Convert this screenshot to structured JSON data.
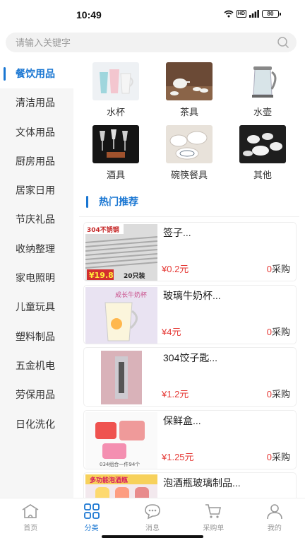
{
  "status": {
    "time": "10:49",
    "network": "HD",
    "battery": "80"
  },
  "search": {
    "placeholder": "请输入关键字"
  },
  "sidebar": {
    "items": [
      {
        "label": "餐饮用品",
        "active": true
      },
      {
        "label": "清洁用品"
      },
      {
        "label": "文体用品"
      },
      {
        "label": "厨房用品"
      },
      {
        "label": "居家日用"
      },
      {
        "label": "节庆礼品"
      },
      {
        "label": "收纳整理"
      },
      {
        "label": "家电照明"
      },
      {
        "label": "儿童玩具"
      },
      {
        "label": "塑料制品"
      },
      {
        "label": "五金机电"
      },
      {
        "label": "劳保用品"
      },
      {
        "label": "日化洗化"
      }
    ]
  },
  "categories": [
    {
      "label": "水杯",
      "icon": "cups-image"
    },
    {
      "label": "茶具",
      "icon": "tea-set-image"
    },
    {
      "label": "水壶",
      "icon": "kettle-image"
    },
    {
      "label": "酒具",
      "icon": "wine-glasses-image"
    },
    {
      "label": "碗筷餐具",
      "icon": "tableware-image"
    },
    {
      "label": "其他",
      "icon": "other-image"
    }
  ],
  "hot": {
    "title": "热门推荐"
  },
  "products": [
    {
      "name": "签子...",
      "price": "¥0.2元",
      "sold": "0",
      "sold_suffix": "采购",
      "image_text": {
        "top": "304不锈钢",
        "price": "¥19.8",
        "count": "20只装"
      }
    },
    {
      "name": "玻璃牛奶杯...",
      "price": "¥4元",
      "sold": "0",
      "sold_suffix": "采购",
      "image_text": {
        "title": "成长牛奶杯"
      }
    },
    {
      "name": "304饺子匙...",
      "price": "¥1.2元",
      "sold": "0",
      "sold_suffix": "采购"
    },
    {
      "name": "保鲜盒...",
      "price": "¥1.25元",
      "sold": "0",
      "sold_suffix": "采购",
      "image_text": {
        "bottom": "034组合一件94个"
      }
    },
    {
      "name": "泡酒瓶玻璃制品...",
      "price": "",
      "sold": "",
      "sold_suffix": "",
      "image_text": {
        "top": "多功能泡酒瓶"
      }
    }
  ],
  "tabs": [
    {
      "label": "首页",
      "icon": "home-icon"
    },
    {
      "label": "分类",
      "icon": "category-icon",
      "active": true
    },
    {
      "label": "消息",
      "icon": "message-icon"
    },
    {
      "label": "采购单",
      "icon": "cart-icon"
    },
    {
      "label": "我的",
      "icon": "profile-icon"
    }
  ],
  "colors": {
    "accent": "#1976d2",
    "price": "#e53935",
    "sidebar_bg": "#f6f6f6"
  }
}
